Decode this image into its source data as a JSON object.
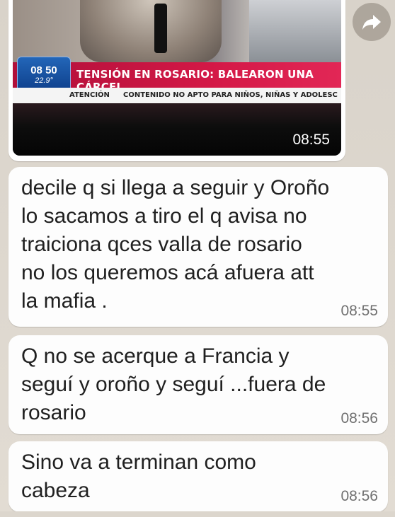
{
  "image_message": {
    "tv": {
      "clock_time": "08 50",
      "temperature": "22.9°",
      "headline": "TENSIÓN EN ROSARIO: BALEARON UNA CÁRCEL",
      "warning_label": "ATENCIÓN",
      "warning_text": "CONTENIDO NO APTO PARA NIÑOS, NIÑAS Y ADOLESC"
    },
    "timestamp": "08:55",
    "forward_icon": "forward-arrow-icon"
  },
  "messages": [
    {
      "text": "decile q si llega a seguir y Oroño\nlo sacamos a tiro el q avisa no\ntraiciona qces valla de rosario\nno los queremos acá afuera att\nla mafia .",
      "timestamp": "08:55"
    },
    {
      "text": "Q no se acerque a Francia y\nseguí y oroño y seguí ...fuera de\nrosario",
      "timestamp": "08:56"
    },
    {
      "text": "Sino va a terminan como\ncabeza",
      "timestamp": "08:56"
    }
  ],
  "colors": {
    "chat_background": "#ded8cf",
    "bubble_background": "#fdfdfd",
    "banner_red": "#d31846",
    "clock_blue": "#1a4f9e"
  }
}
